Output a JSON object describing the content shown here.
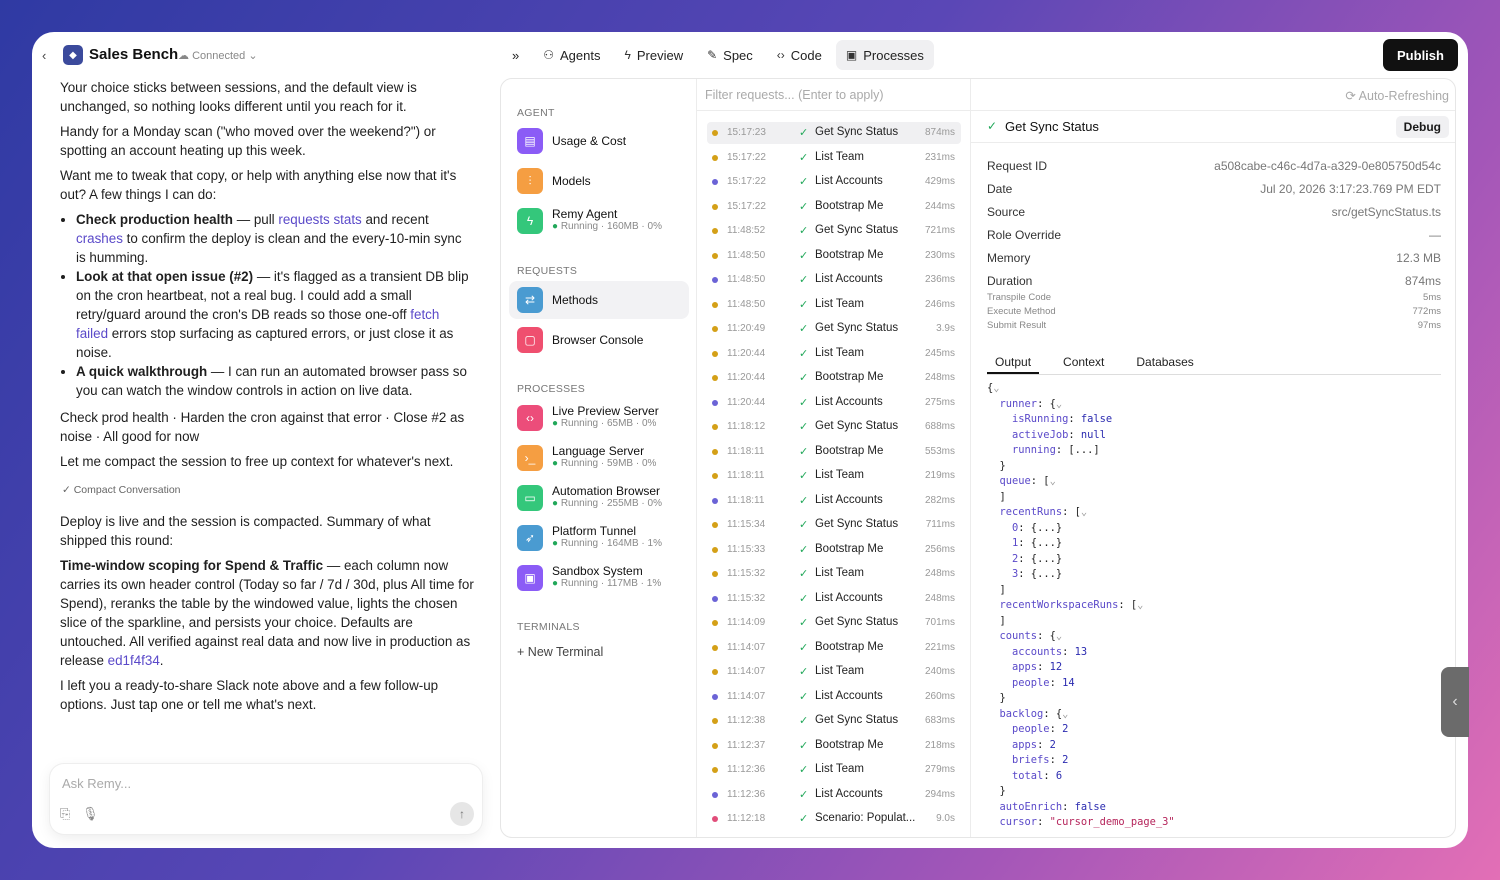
{
  "app": {
    "title": "Sales Bench",
    "status": "Connected"
  },
  "tabs": [
    {
      "label": "Agents",
      "icon": "agents-icon"
    },
    {
      "label": "Preview",
      "icon": "bolt-icon"
    },
    {
      "label": "Spec",
      "icon": "edit-icon"
    },
    {
      "label": "Code",
      "icon": "code-icon"
    },
    {
      "label": "Processes",
      "icon": "cpu-icon"
    }
  ],
  "publish": "Publish",
  "chat": {
    "p1": "Your choice sticks between sessions, and the default view is unchanged, so nothing looks different until you reach for it.",
    "p2": "Handy for a Monday scan (\"who moved over the weekend?\") or spotting an account heating up this week.",
    "p3": "Want me to tweak that copy, or help with anything else now that it's out? A few things I can do:",
    "b1_bold": "Check production health",
    "b1_a": " — pull ",
    "b1_link1": "requests stats",
    "b1_b": " and recent ",
    "b1_link2": "crashes",
    "b1_c": " to confirm the deploy is clean and the every-10-min sync is humming.",
    "b2_bold": "Look at that open issue (#2)",
    "b2_a": " — it's flagged as a transient DB blip on the cron heartbeat, not a real bug. I could add a small retry/guard around the cron's DB reads so those one-off ",
    "b2_link": "fetch failed",
    "b2_b": " errors stop surfacing as captured errors, or just close it as noise.",
    "b3_bold": "A quick walkthrough",
    "b3_a": " — I can run an automated browser pass so you can watch the window controls in action on live data.",
    "p4": "Check prod health · Harden the cron against that error · Close #2 as noise · All good for now",
    "p5": "Let me compact the session to free up context for whatever's next.",
    "compact": "Compact Conversation",
    "p6": "Deploy is live and the session is compacted. Summary of what shipped this round:",
    "p7_bold": "Time-window scoping for Spend & Traffic",
    "p7_a": " — each column now carries its own header control (Today so far / 7d / 30d, plus All time for Spend), reranks the table by the windowed value, lights the chosen slice of the sparkline, and persists your choice. Defaults are untouched. All verified against real data and now live in production as release ",
    "p7_link": "ed1f4f34",
    "p7_b": ".",
    "p8": "I left you a ready-to-share Slack note above and a few follow-up options. Just tap one or tell me what's next."
  },
  "composer": {
    "placeholder": "Ask Remy..."
  },
  "sidebar": {
    "agent_label": "AGENT",
    "requests_label": "REQUESTS",
    "processes_label": "PROCESSES",
    "terminals_label": "TERMINALS",
    "agent": [
      {
        "name": "Usage & Cost",
        "color": "#8b5cf6",
        "icon": "receipt-icon"
      },
      {
        "name": "Models",
        "color": "#f59e42",
        "icon": "sliders-icon"
      },
      {
        "name": "Remy Agent",
        "status": "Running · 160MB · 0%",
        "color": "#34c77b",
        "icon": "bolt-icon"
      }
    ],
    "requests": [
      {
        "name": "Methods",
        "color": "#4a9bd1",
        "icon": "arrows-icon"
      },
      {
        "name": "Browser Console",
        "color": "#ef4f6f",
        "icon": "console-icon"
      }
    ],
    "processes": [
      {
        "name": "Live Preview Server",
        "status": "Running · 65MB · 0%",
        "color": "#ec4d7a",
        "icon": "code-icon"
      },
      {
        "name": "Language Server",
        "status": "Running · 59MB · 0%",
        "color": "#f59e42",
        "icon": "terminal-icon"
      },
      {
        "name": "Automation Browser",
        "status": "Running · 255MB · 0%",
        "color": "#34c77b",
        "icon": "monitor-icon"
      },
      {
        "name": "Platform Tunnel",
        "status": "Running · 164MB · 1%",
        "color": "#4a9bd1",
        "icon": "rocket-icon"
      },
      {
        "name": "Sandbox System",
        "status": "Running · 117MB · 1%",
        "color": "#8b5cf6",
        "icon": "box-icon"
      }
    ],
    "new_terminal": "New Terminal"
  },
  "filter": {
    "placeholder": "Filter requests... (Enter to apply)",
    "auto": "Auto-Refreshing"
  },
  "requests": [
    {
      "time": "15:17:23",
      "name": "Get Sync Status",
      "ms": "874ms",
      "color": "#d4a017"
    },
    {
      "time": "15:17:22",
      "name": "List Team",
      "ms": "231ms",
      "color": "#d4a017"
    },
    {
      "time": "15:17:22",
      "name": "List Accounts",
      "ms": "429ms",
      "color": "#6b63d6"
    },
    {
      "time": "15:17:22",
      "name": "Bootstrap Me",
      "ms": "244ms",
      "color": "#d4a017"
    },
    {
      "time": "11:48:52",
      "name": "Get Sync Status",
      "ms": "721ms",
      "color": "#d4a017"
    },
    {
      "time": "11:48:50",
      "name": "Bootstrap Me",
      "ms": "230ms",
      "color": "#d4a017"
    },
    {
      "time": "11:48:50",
      "name": "List Accounts",
      "ms": "236ms",
      "color": "#6b63d6"
    },
    {
      "time": "11:48:50",
      "name": "List Team",
      "ms": "246ms",
      "color": "#d4a017"
    },
    {
      "time": "11:20:49",
      "name": "Get Sync Status",
      "ms": "3.9s",
      "color": "#d4a017"
    },
    {
      "time": "11:20:44",
      "name": "List Team",
      "ms": "245ms",
      "color": "#d4a017"
    },
    {
      "time": "11:20:44",
      "name": "Bootstrap Me",
      "ms": "248ms",
      "color": "#d4a017"
    },
    {
      "time": "11:20:44",
      "name": "List Accounts",
      "ms": "275ms",
      "color": "#6b63d6"
    },
    {
      "time": "11:18:12",
      "name": "Get Sync Status",
      "ms": "688ms",
      "color": "#d4a017"
    },
    {
      "time": "11:18:11",
      "name": "Bootstrap Me",
      "ms": "553ms",
      "color": "#d4a017"
    },
    {
      "time": "11:18:11",
      "name": "List Team",
      "ms": "219ms",
      "color": "#d4a017"
    },
    {
      "time": "11:18:11",
      "name": "List Accounts",
      "ms": "282ms",
      "color": "#6b63d6"
    },
    {
      "time": "11:15:34",
      "name": "Get Sync Status",
      "ms": "711ms",
      "color": "#d4a017"
    },
    {
      "time": "11:15:33",
      "name": "Bootstrap Me",
      "ms": "256ms",
      "color": "#d4a017"
    },
    {
      "time": "11:15:32",
      "name": "List Team",
      "ms": "248ms",
      "color": "#d4a017"
    },
    {
      "time": "11:15:32",
      "name": "List Accounts",
      "ms": "248ms",
      "color": "#6b63d6"
    },
    {
      "time": "11:14:09",
      "name": "Get Sync Status",
      "ms": "701ms",
      "color": "#d4a017"
    },
    {
      "time": "11:14:07",
      "name": "Bootstrap Me",
      "ms": "221ms",
      "color": "#d4a017"
    },
    {
      "time": "11:14:07",
      "name": "List Team",
      "ms": "240ms",
      "color": "#d4a017"
    },
    {
      "time": "11:14:07",
      "name": "List Accounts",
      "ms": "260ms",
      "color": "#6b63d6"
    },
    {
      "time": "11:12:38",
      "name": "Get Sync Status",
      "ms": "683ms",
      "color": "#d4a017"
    },
    {
      "time": "11:12:37",
      "name": "Bootstrap Me",
      "ms": "218ms",
      "color": "#d4a017"
    },
    {
      "time": "11:12:36",
      "name": "List Team",
      "ms": "279ms",
      "color": "#d4a017"
    },
    {
      "time": "11:12:36",
      "name": "List Accounts",
      "ms": "294ms",
      "color": "#6b63d6"
    },
    {
      "time": "11:12:18",
      "name": "Scenario: Populat...",
      "ms": "9.0s",
      "color": "#e14d7a"
    }
  ],
  "detail": {
    "title": "Get Sync Status",
    "debug": "Debug",
    "fields": [
      {
        "k": "Request ID",
        "v": "a508cabe-c46c-4d7a-a329-0e805750d54c"
      },
      {
        "k": "Date",
        "v": "Jul 20, 2026 3:17:23.769 PM EDT"
      },
      {
        "k": "Source",
        "v": "src/getSyncStatus.ts"
      },
      {
        "k": "Role Override",
        "v": "—"
      },
      {
        "k": "Memory",
        "v": "12.3 MB"
      },
      {
        "k": "Duration",
        "v": "874ms"
      }
    ],
    "sub": [
      {
        "k": "Transpile Code",
        "v": "5ms"
      },
      {
        "k": "Execute Method",
        "v": "772ms"
      },
      {
        "k": "Submit Result",
        "v": "97ms"
      }
    ],
    "tabs": [
      "Output",
      "Context",
      "Databases"
    ]
  }
}
